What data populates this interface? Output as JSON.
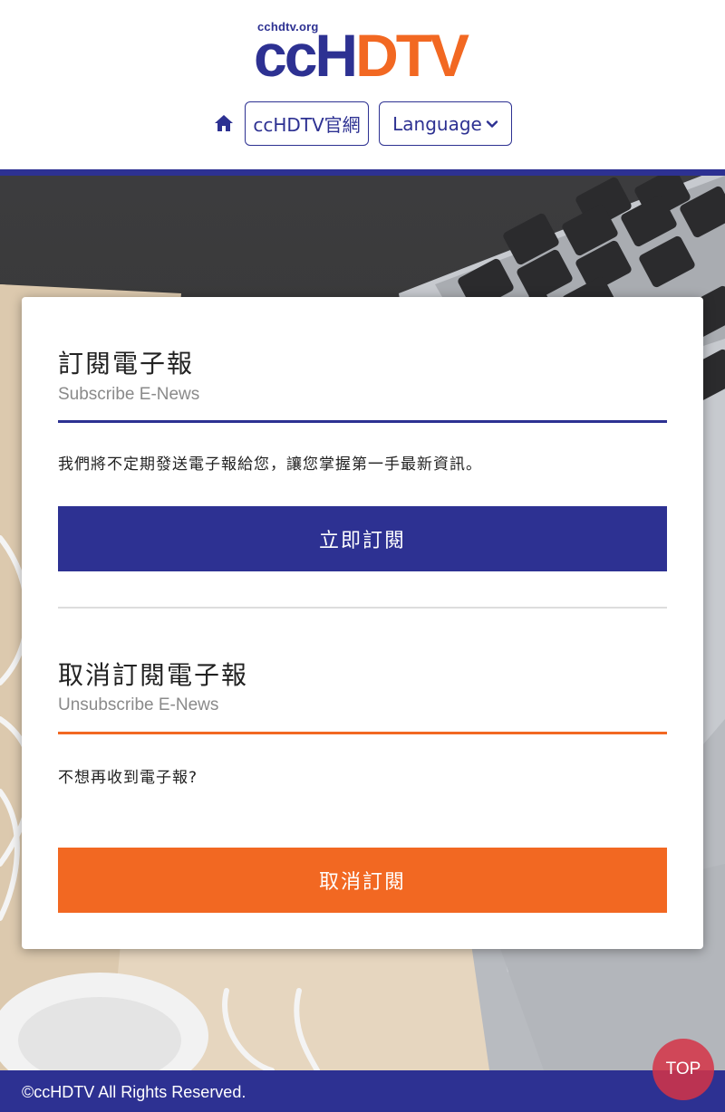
{
  "header": {
    "logo_sub": "cchdtv.org",
    "logo_cc": "ccH",
    "logo_dtv": "DTV"
  },
  "nav": {
    "official_site": "ccHDTV官網",
    "language": "Language"
  },
  "subscribe": {
    "title": "訂閱電子報",
    "subtitle": "Subscribe E-News",
    "description": "我們將不定期發送電子報給您，讓您掌握第一手最新資訊。",
    "button": "立即訂閱"
  },
  "unsubscribe": {
    "title": "取消訂閱電子報",
    "subtitle": "Unsubscribe E-News",
    "description": "不想再收到電子報?",
    "button": "取消訂閱"
  },
  "footer": {
    "copyright": "©ccHDTV All Rights Reserved."
  },
  "top_button": "TOP",
  "colors": {
    "brand_blue": "#2d3192",
    "brand_orange": "#f26822",
    "top_button": "#d53446"
  },
  "icons": {
    "home": "home-icon",
    "language_dropdown": "chevron-down-icon"
  }
}
